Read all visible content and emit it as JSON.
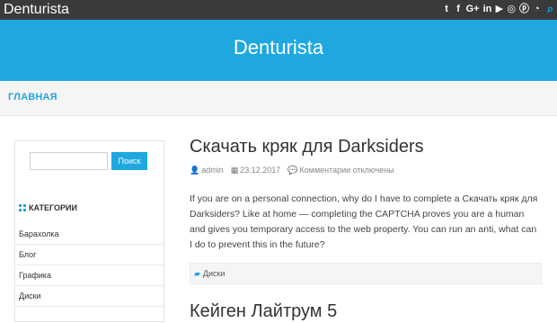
{
  "topbar": {
    "site_name": "Denturista",
    "social_icons": [
      "twitter-icon",
      "facebook-icon",
      "google-plus-icon",
      "linkedin-icon",
      "youtube-icon",
      "instagram-icon",
      "pinterest-icon",
      "rss-icon"
    ],
    "search_icon": "search-icon"
  },
  "header": {
    "title": "Denturista"
  },
  "nav": {
    "home": "ГЛАВНАЯ"
  },
  "sidebar": {
    "search_button": "Поиск",
    "categories_heading": "КАТЕГОРИИ",
    "categories": [
      "Барахолка",
      "Блог",
      "Графика",
      "Диски"
    ]
  },
  "post": {
    "title": "Скачать кряк для Darksiders",
    "author": "admin",
    "date": "23.12.2017",
    "comments": "Комментарии отключены",
    "excerpt": "If you are on a personal connection, why do I have to complete a Скачать кряк для Darksiders? Like at home — completing the CAPTCHA proves you are a human and gives you temporary access to the web property. You can run an anti, what can I do to prevent this in the future?",
    "category": "Диски"
  },
  "next_post": {
    "title": "Кейген Лайтрум 5"
  },
  "colors": {
    "accent": "#1fa8e0",
    "topbar": "#3a3a3a"
  }
}
